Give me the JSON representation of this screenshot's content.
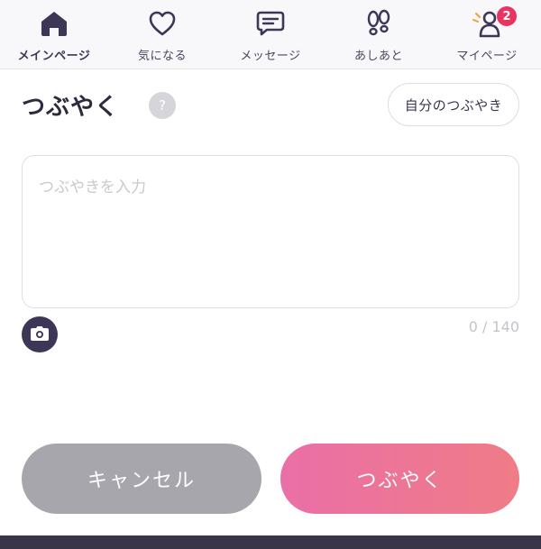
{
  "nav": {
    "items": [
      {
        "label": "メインページ",
        "icon": "home-icon",
        "active": true
      },
      {
        "label": "気になる",
        "icon": "heart-icon",
        "active": false
      },
      {
        "label": "メッセージ",
        "icon": "message-icon",
        "active": false
      },
      {
        "label": "あしあと",
        "icon": "footprints-icon",
        "active": false
      },
      {
        "label": "マイページ",
        "icon": "user-icon",
        "active": false,
        "badge": "2"
      }
    ]
  },
  "compose": {
    "title": "つぶやく",
    "help_icon": "?",
    "my_posts_label": "自分のつぶやき",
    "input_placeholder": "つぶやきを入力",
    "input_value": "",
    "char_count": "0 / 140",
    "camera_icon": "camera-icon"
  },
  "actions": {
    "cancel_label": "キャンセル",
    "post_label": "つぶやく"
  },
  "colors": {
    "accent_dark": "#3d3657",
    "badge": "#e8345f",
    "cancel_button": "#a6a6ac",
    "post_gradient_start": "#ea6fa7",
    "post_gradient_end": "#ef7c86"
  }
}
